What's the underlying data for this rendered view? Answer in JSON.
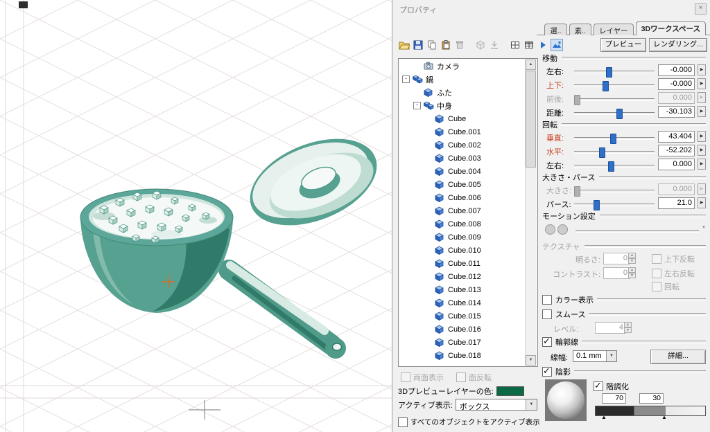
{
  "window": {
    "title": "プロパティ",
    "close_label": "×"
  },
  "tabs": {
    "items": [
      {
        "label": "選..",
        "active": false
      },
      {
        "label": "素..",
        "active": false
      },
      {
        "label": "レイヤー",
        "active": false
      },
      {
        "label": "3Dワークスペース",
        "active": true
      }
    ]
  },
  "toolbar": {
    "icons": [
      "open-file-icon",
      "save-icon",
      "copy-icon",
      "paste-icon",
      "delete-icon",
      "object-disabled-icon",
      "import-disabled-icon",
      "grid-icon",
      "table-icon",
      "play-icon",
      "preview-display-icon"
    ],
    "preview_button": "プレビュー",
    "render_button": "レンダリング..."
  },
  "tree": {
    "items": [
      {
        "label": "カメラ",
        "icon": "camera",
        "depth": 1,
        "expander": false
      },
      {
        "label": "鍋",
        "icon": "group",
        "depth": 0,
        "expander": true
      },
      {
        "label": "ふた",
        "icon": "cube",
        "depth": 1,
        "expander": false
      },
      {
        "label": "中身",
        "icon": "group",
        "depth": 1,
        "expander": true
      },
      {
        "label": "Cube",
        "icon": "cube",
        "depth": 2,
        "expander": false
      },
      {
        "label": "Cube.001",
        "icon": "cube",
        "depth": 2,
        "expander": false
      },
      {
        "label": "Cube.002",
        "icon": "cube",
        "depth": 2,
        "expander": false
      },
      {
        "label": "Cube.003",
        "icon": "cube",
        "depth": 2,
        "expander": false
      },
      {
        "label": "Cube.004",
        "icon": "cube",
        "depth": 2,
        "expander": false
      },
      {
        "label": "Cube.005",
        "icon": "cube",
        "depth": 2,
        "expander": false
      },
      {
        "label": "Cube.006",
        "icon": "cube",
        "depth": 2,
        "expander": false
      },
      {
        "label": "Cube.007",
        "icon": "cube",
        "depth": 2,
        "expander": false
      },
      {
        "label": "Cube.008",
        "icon": "cube",
        "depth": 2,
        "expander": false
      },
      {
        "label": "Cube.009",
        "icon": "cube",
        "depth": 2,
        "expander": false
      },
      {
        "label": "Cube.010",
        "icon": "cube",
        "depth": 2,
        "expander": false
      },
      {
        "label": "Cube.011",
        "icon": "cube",
        "depth": 2,
        "expander": false
      },
      {
        "label": "Cube.012",
        "icon": "cube",
        "depth": 2,
        "expander": false
      },
      {
        "label": "Cube.013",
        "icon": "cube",
        "depth": 2,
        "expander": false
      },
      {
        "label": "Cube.014",
        "icon": "cube",
        "depth": 2,
        "expander": false
      },
      {
        "label": "Cube.015",
        "icon": "cube",
        "depth": 2,
        "expander": false
      },
      {
        "label": "Cube.016",
        "icon": "cube",
        "depth": 2,
        "expander": false
      },
      {
        "label": "Cube.017",
        "icon": "cube",
        "depth": 2,
        "expander": false
      },
      {
        "label": "Cube.018",
        "icon": "cube",
        "depth": 2,
        "expander": false
      }
    ]
  },
  "tree_footer": {
    "double_sided": "両面表示",
    "flip_face": "面反転",
    "layer_color_label": "3Dプレビューレイヤーの色:",
    "layer_color": "#0b6a45",
    "active_display_label": "アクティブ表示:",
    "active_display_value": "ボックス",
    "all_objects_active": "すべてのオブジェクトをアクティブ表示"
  },
  "move": {
    "header": "移動",
    "rows": [
      {
        "label": "左右:",
        "value": "-0.000",
        "state": "normal",
        "frac": 0.42
      },
      {
        "label": "上下:",
        "value": "-0.000",
        "state": "red",
        "frac": 0.38
      },
      {
        "label": "前後:",
        "value": "0.000",
        "state": "disabled",
        "frac": 0.03
      },
      {
        "label": "距離:",
        "value": "-30.103",
        "state": "normal",
        "frac": 0.55
      }
    ]
  },
  "rotate": {
    "header": "回転",
    "rows": [
      {
        "label": "垂直:",
        "value": "43.404",
        "state": "red",
        "frac": 0.47
      },
      {
        "label": "水平:",
        "value": "-52.202",
        "state": "red",
        "frac": 0.34
      },
      {
        "label": "左右:",
        "value": "0.000",
        "state": "normal",
        "frac": 0.45
      }
    ]
  },
  "scale": {
    "header": "大きさ・パース",
    "rows": [
      {
        "label": "大きさ:",
        "value": "0.000",
        "state": "disabled",
        "frac": 0.03
      },
      {
        "label": "パース:",
        "value": "21.0",
        "state": "normal",
        "frac": 0.27
      }
    ]
  },
  "motion": {
    "header": "モーション設定"
  },
  "texture": {
    "header": "テクスチャ",
    "brightness_label": "明るさ:",
    "brightness_value": "0",
    "contrast_label": "コントラスト:",
    "contrast_value": "0",
    "flip_v": "上下反転",
    "flip_h": "左右反転",
    "rotate": "回転"
  },
  "options": {
    "color_display": {
      "label": "カラー表示",
      "checked": false
    },
    "smooth": {
      "label": "スムース",
      "checked": false
    },
    "level_label": "レベル:",
    "level_value": "4",
    "outline": {
      "label": "輪郭線",
      "checked": true
    },
    "line_width_label": "線幅:",
    "line_width_value": "0.1 mm",
    "detail_button": "詳細...",
    "shading": {
      "label": "陰影",
      "checked": true
    },
    "tone": {
      "label": "階調化",
      "checked": true
    },
    "tone_value_1": "70",
    "tone_value_2": "30"
  }
}
